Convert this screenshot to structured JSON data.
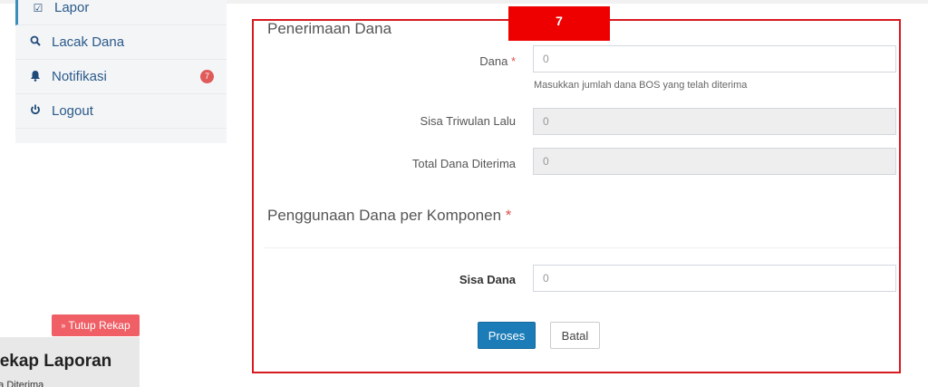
{
  "sidebar": {
    "items": [
      {
        "label": "Lapor",
        "icon": "check-square-icon"
      },
      {
        "label": "Lacak Dana",
        "icon": "search-icon"
      },
      {
        "label": "Notifikasi",
        "icon": "bell-icon",
        "badge": "7"
      },
      {
        "label": "Logout",
        "icon": "power-icon"
      }
    ]
  },
  "rekap": {
    "toggle_label": "Tutup Rekap",
    "title": "Rekap Laporan",
    "subtitle": "Dana Diterima"
  },
  "step": "7",
  "form": {
    "section_title": "Penerimaan Dana",
    "dana": {
      "label": "Dana",
      "required_mark": "*",
      "value": "0",
      "help": "Masukkan jumlah dana BOS yang telah diterima"
    },
    "sisa_triwulan": {
      "label": "Sisa Triwulan Lalu",
      "value": "0"
    },
    "total_dana": {
      "label": "Total Dana Diterima",
      "value": "0"
    },
    "komponen_title": "Penggunaan Dana per Komponen",
    "komponen_required_mark": "*",
    "sisa_dana": {
      "label": "Sisa Dana",
      "value": "0"
    },
    "proses_label": "Proses",
    "batal_label": "Batal"
  },
  "colors": {
    "highlight": "#d71920",
    "primary": "#1b7cb7",
    "danger": "#ef5f65"
  }
}
